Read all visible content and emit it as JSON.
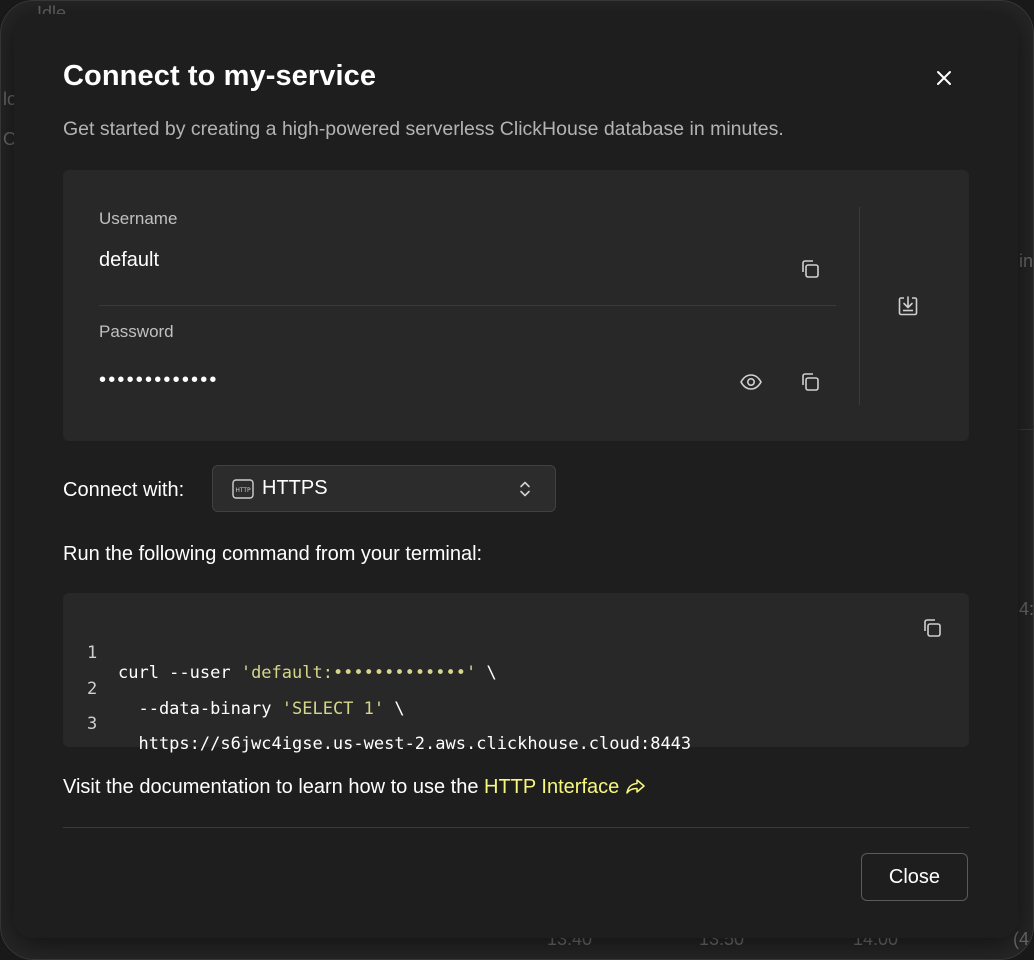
{
  "background": {
    "texts": [
      "Idle",
      "lo",
      "Or",
      "in",
      "4:",
      "13:40",
      "13:50",
      "14:00",
      "(4"
    ]
  },
  "modal": {
    "title": "Connect to my-service",
    "subtitle": "Get started by creating a high-powered serverless ClickHouse database in minutes.",
    "close_icon": "close-icon"
  },
  "credentials": {
    "username_label": "Username",
    "username_value": "default",
    "password_label": "Password",
    "password_value": "•••••••••••••",
    "icons": [
      "copy-icon",
      "eye-icon",
      "copy-icon",
      "download-icon"
    ]
  },
  "connect": {
    "label": "Connect with:",
    "selected": "HTTPS",
    "icon": "http-icon"
  },
  "run_label": "Run the following command from your terminal:",
  "code": {
    "lines": [
      {
        "num": "1",
        "pre": "curl --user ",
        "str": "'default:•••••••••••••'",
        "post": " \\"
      },
      {
        "num": "2",
        "pre": "  --data-binary ",
        "str": "'SELECT 1'",
        "post": " \\"
      },
      {
        "num": "3",
        "pre": "  https://s6jwc4igse.us-west-2.aws.clickhouse.cloud:8443",
        "str": "",
        "post": ""
      }
    ]
  },
  "docs": {
    "text": "Visit the documentation to learn how to use the ",
    "link": "HTTP Interface"
  },
  "footer": {
    "close_label": "Close"
  },
  "colors": {
    "accent": "#f7f77e",
    "code_string": "#d6d68a",
    "modal_bg": "#1e1e1e",
    "card_bg": "#282828"
  }
}
